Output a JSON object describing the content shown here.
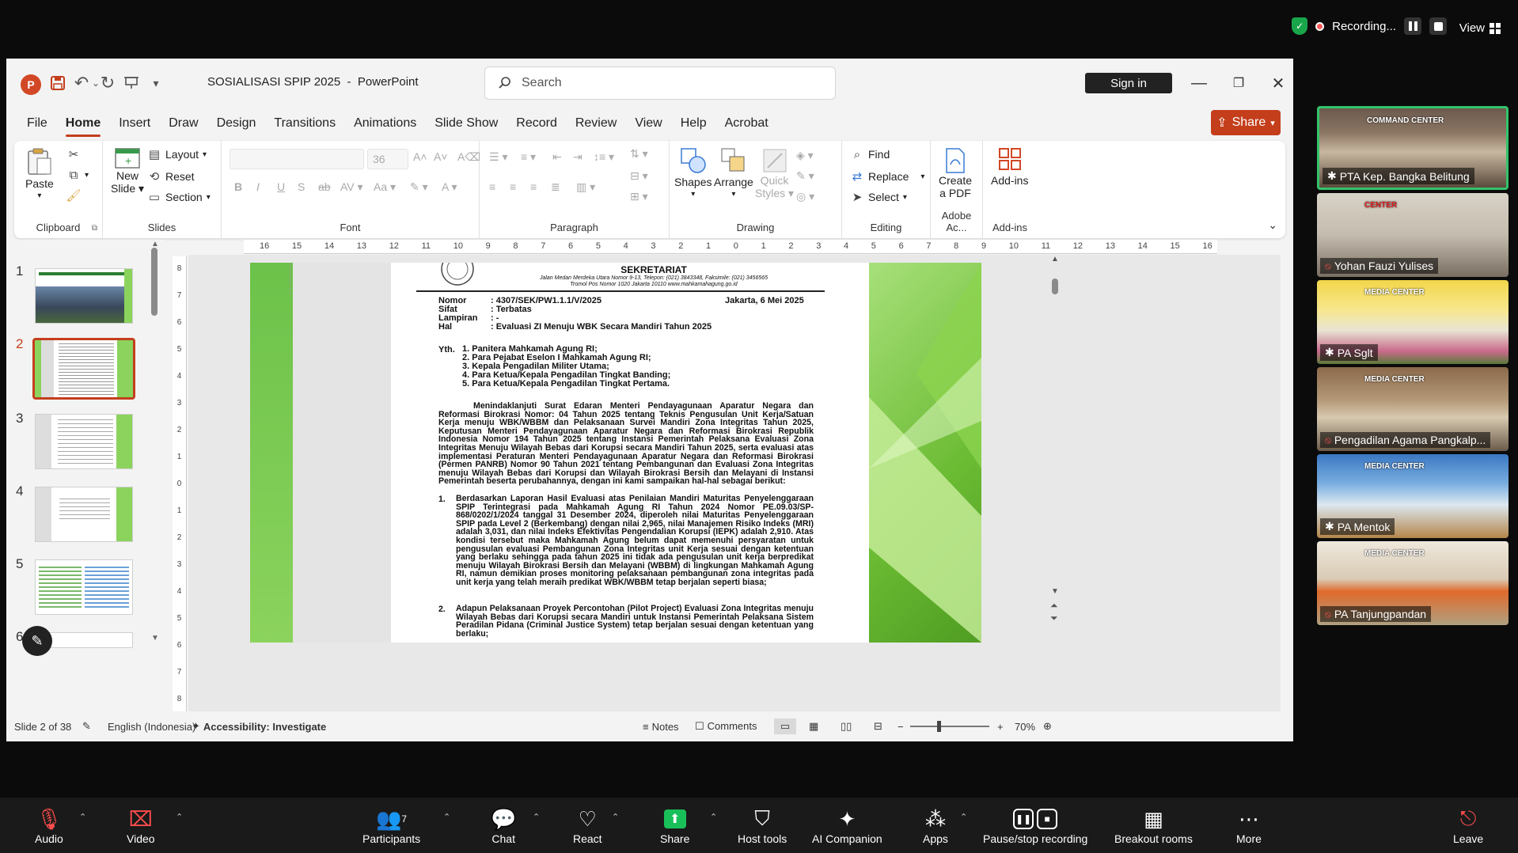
{
  "zoom": {
    "recording_label": "Recording...",
    "view_label": "View",
    "bottom": {
      "audio": "Audio",
      "video": "Video",
      "participants": "Participants",
      "participants_count": "7",
      "chat": "Chat",
      "react": "React",
      "share": "Share",
      "host_tools": "Host tools",
      "ai_companion": "AI Companion",
      "apps": "Apps",
      "pause_recording": "Pause/stop recording",
      "breakout": "Breakout rooms",
      "more": "More",
      "leave": "Leave"
    },
    "participants_tiles": [
      {
        "name": "PTA Kep. Bangka Belitung",
        "muted": false,
        "sign": "COMMAND CENTER"
      },
      {
        "name": "Yohan Fauzi Yulises",
        "muted": true,
        "sign": "CENTER"
      },
      {
        "name": "PA Sglt",
        "muted": false,
        "sign": "MEDIA CENTER"
      },
      {
        "name": "Pengadilan Agama Pangkalp...",
        "muted": true,
        "sign": "MEDIA CENTER"
      },
      {
        "name": "PA Mentok",
        "muted": false,
        "sign": "MEDIA CENTER"
      },
      {
        "name": "PA Tanjungpandan",
        "muted": true,
        "sign": "MEDIA CENTER"
      }
    ]
  },
  "ppt": {
    "doc_title": "SOSIALISASI SPIP 2025",
    "app_name": "PowerPoint",
    "search_placeholder": "Search",
    "sign_in": "Sign in",
    "share": "Share",
    "menu": [
      "File",
      "Home",
      "Insert",
      "Draw",
      "Design",
      "Transitions",
      "Animations",
      "Slide Show",
      "Record",
      "Review",
      "View",
      "Help",
      "Acrobat"
    ],
    "ribbon": {
      "clipboard": {
        "label": "Clipboard",
        "paste": "Paste"
      },
      "slides": {
        "label": "Slides",
        "new_slide": "New",
        "new_slide2": "Slide",
        "layout": "Layout",
        "reset": "Reset",
        "section": "Section"
      },
      "font": {
        "label": "Font",
        "font_size": "36"
      },
      "paragraph": {
        "label": "Paragraph"
      },
      "drawing": {
        "label": "Drawing",
        "shapes": "Shapes",
        "arrange": "Arrange",
        "quick_styles": "Quick",
        "quick_styles2": "Styles"
      },
      "editing": {
        "label": "Editing",
        "find": "Find",
        "replace": "Replace",
        "select": "Select"
      },
      "adobe": {
        "label": "Adobe Ac...",
        "create_pdf": "Create",
        "create_pdf2": "a PDF"
      },
      "addins": {
        "label": "Add-ins",
        "addins": "Add-ins"
      }
    },
    "thumbs": [
      "1",
      "2",
      "3",
      "4",
      "5",
      "6"
    ],
    "ruler_h": [
      "16",
      "15",
      "14",
      "13",
      "12",
      "11",
      "10",
      "9",
      "8",
      "7",
      "6",
      "5",
      "4",
      "3",
      "2",
      "1",
      "0",
      "1",
      "2",
      "3",
      "4",
      "5",
      "6",
      "7",
      "8",
      "9",
      "10",
      "11",
      "12",
      "13",
      "14",
      "15",
      "16"
    ],
    "ruler_v": [
      "8",
      "7",
      "6",
      "5",
      "4",
      "3",
      "2",
      "1",
      "0",
      "1",
      "2",
      "3",
      "4",
      "5",
      "6",
      "7",
      "8"
    ],
    "status": {
      "slide_info": "Slide 2 of 38",
      "language": "English (Indonesia)",
      "accessibility": "Accessibility: Investigate",
      "notes": "Notes",
      "comments": "Comments",
      "zoom": "70%"
    },
    "letter": {
      "header_title": "SEKRETARIAT",
      "header_addr1": "Jalan Medan Merdeka Utara Nomor 9-13, Telepon: (021) 3843348, Faksimile: (021) 3456565",
      "header_addr2": "Tromol Pos Nomor 1020 Jakarta 10110 www.mahkamahagung.go.id",
      "nomor_label": "Nomor",
      "nomor": ": 4307/SEK/PW1.1.1/V/2025",
      "date": "Jakarta, 6 Mei 2025",
      "sifat_label": "Sifat",
      "sifat": ": Terbatas",
      "lampiran_label": "Lampiran",
      "lampiran": ": -",
      "hal_label": "Hal",
      "hal": ": Evaluasi ZI Menuju WBK Secara Mandiri Tahun 2025",
      "yth": "Yth.",
      "recipients": [
        "1. Panitera Mahkamah Agung RI;",
        "2. Para Pejabat Eselon I Mahkamah Agung RI;",
        "3. Kepala Pengadilan Militer Utama;",
        "4. Para Ketua/Kepala Pengadilan Tingkat Banding;",
        "5. Para Ketua/Kepala Pengadilan Tingkat Pertama."
      ],
      "body": "Menindaklanjuti Surat Edaran Menteri Pendayagunaan Aparatur Negara dan Reformasi Birokrasi Nomor: 04 Tahun 2025 tentang Teknis Pengusulan Unit Kerja/Satuan Kerja menuju WBK/WBBM dan Pelaksanaan Survei Mandiri Zona Integritas Tahun 2025, Keputusan Menteri Pendayagunaan Aparatur Negara dan Reformasi Birokrasi Republik Indonesia Nomor 194 Tahun 2025 tentang Instansi Pemerintah Pelaksana Evaluasi Zona Integritas Menuju Wilayah Bebas dari Korupsi secara Mandiri Tahun 2025, serta evaluasi atas implementasi Peraturan Menteri Pendayagunaan Aparatur Negara dan Reformasi Birokrasi (Permen PANRB) Nomor 90 Tahun 2021 tentang Pembangunan dan Evaluasi Zona Integritas menuju Wilayah Bebas dari Korupsi dan Wilayah Birokrasi Bersih dan Melayani di Instansi Pemerintah beserta perubahannya, dengan ini kami sampaikan hal-hal sebagai berikut:",
      "point1_num": "1.",
      "point1": "Berdasarkan Laporan Hasil Evaluasi atas Penilaian Mandiri Maturitas Penyelenggaraan SPIP Terintegrasi pada Mahkamah Agung RI Tahun 2024 Nomor PE.09.03/SP-868/0202/1/2024 tanggal 31 Desember 2024, diperoleh nilai Maturitas Penyelenggaraan SPIP pada Level 2 (Berkembang) dengan nilai 2,965, nilai Manajemen Risiko Indeks (MRI) adalah 3,031, dan nilai Indeks Efektivitas Pengendalian Korupsi (IEPK) adalah 2,910. Atas kondisi tersebut maka Mahkamah Agung belum dapat memenuhi persyaratan untuk pengusulan evaluasi Pembangunan Zona Integritas unit Kerja sesuai dengan ketentuan yang berlaku sehingga pada tahun 2025 ini tidak ada pengusulan unit kerja berpredikat menuju Wilayah Birokrasi Bersih dan Melayani (WBBM) di lingkungan Mahkamah Agung RI, namun demikian proses monitoring pelaksanaan pembangunan zona integritas pada unit kerja yang telah meraih predikat WBK/WBBM tetap berjalan seperti biasa;",
      "point2_num": "2.",
      "point2": "Adapun Pelaksanaan Proyek Percontohan (Pilot Project) Evaluasi Zona Integritas menuju Wilayah Bebas dari Korupsi secara Mandiri untuk Instansi Pemerintah Pelaksana Sistem Peradilan Pidana (Criminal Justice System) tetap berjalan sesuai dengan ketentuan yang berlaku;"
    }
  },
  "colors": {
    "accent": "#c43e1c",
    "zoom_green": "#33c36b",
    "slide_green": "#6cc24a"
  }
}
